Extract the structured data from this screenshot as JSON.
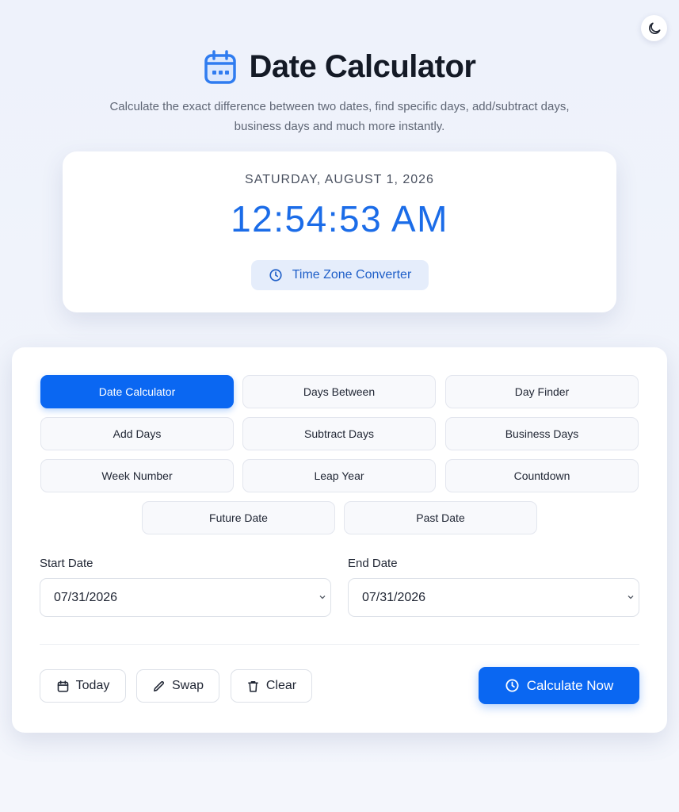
{
  "header": {
    "title": "Date Calculator",
    "subtitle": "Calculate the exact difference between two dates, find specific days, add/subtract days, business days and much more instantly."
  },
  "clock": {
    "date": "SATURDAY, AUGUST 1, 2026",
    "time": "12:54:53 AM",
    "timezone_button": "Time Zone Converter"
  },
  "tabs": [
    {
      "label": "Date Calculator",
      "active": true
    },
    {
      "label": "Days Between",
      "active": false
    },
    {
      "label": "Day Finder",
      "active": false
    },
    {
      "label": "Add Days",
      "active": false
    },
    {
      "label": "Subtract Days",
      "active": false
    },
    {
      "label": "Business Days",
      "active": false
    },
    {
      "label": "Week Number",
      "active": false
    },
    {
      "label": "Leap Year",
      "active": false
    },
    {
      "label": "Countdown",
      "active": false
    },
    {
      "label": "Future Date",
      "active": false
    },
    {
      "label": "Past Date",
      "active": false
    }
  ],
  "form": {
    "start_label": "Start Date",
    "start_value": "07/31/2026",
    "end_label": "End Date",
    "end_value": "07/31/2026"
  },
  "actions": {
    "today": "Today",
    "swap": "Swap",
    "clear": "Clear",
    "calculate": "Calculate Now"
  },
  "icons": {
    "theme": "moon-icon",
    "logo": "calendar-icon",
    "timezone": "clock-icon",
    "today": "calendar-icon",
    "swap": "pencil-icon",
    "clear": "trash-icon",
    "calculate": "clock-icon"
  },
  "colors": {
    "accent": "#0a67f2",
    "time_text": "#1b6ce8",
    "timezone_bg": "#e5edfb",
    "background": "#eef2fb"
  }
}
